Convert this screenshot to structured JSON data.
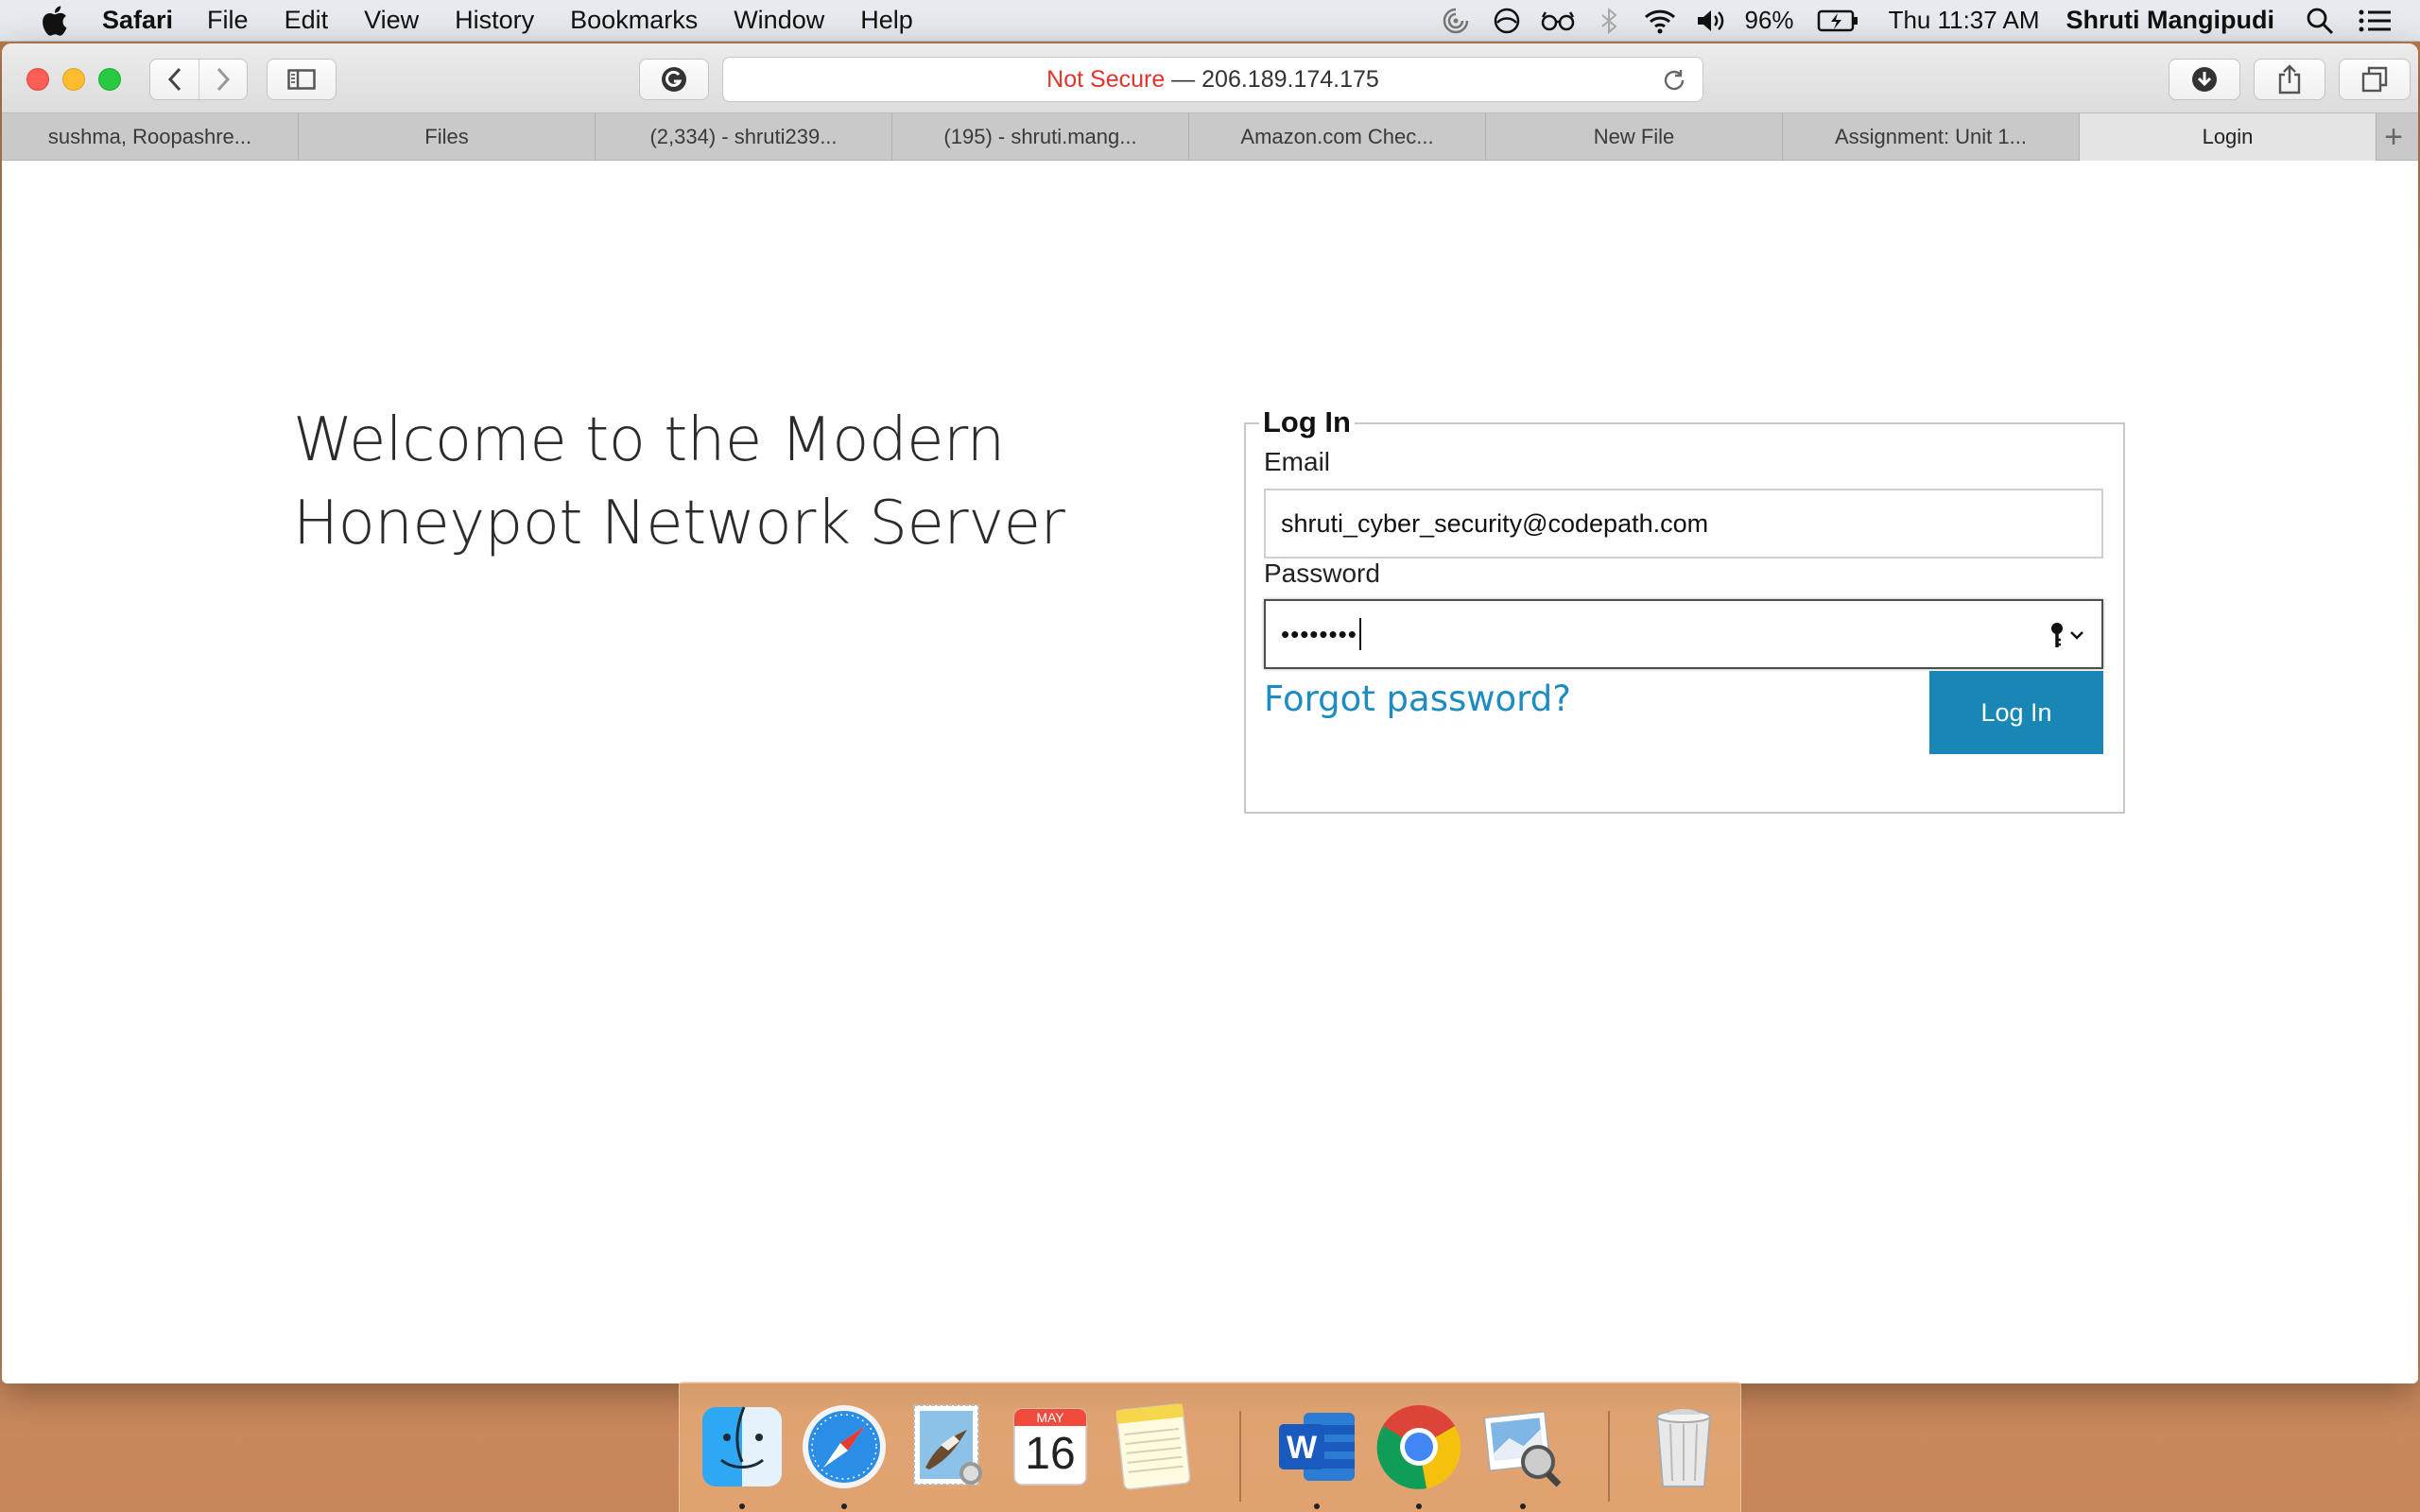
{
  "menubar": {
    "app_name": "Safari",
    "items": [
      "File",
      "Edit",
      "View",
      "History",
      "Bookmarks",
      "Window",
      "Help"
    ],
    "battery": "96%",
    "clock": "Thu 11:37 AM",
    "user": "Shruti Mangipudi"
  },
  "toolbar": {
    "url_prefix": "Not Secure",
    "url_separator": " — ",
    "url_host": "206.189.174.175"
  },
  "tabs": [
    {
      "label": "sushma, Roopashre..."
    },
    {
      "label": "Files"
    },
    {
      "label": "(2,334) - shruti239..."
    },
    {
      "label": "(195) - shruti.mang..."
    },
    {
      "label": "Amazon.com Chec..."
    },
    {
      "label": "New File"
    },
    {
      "label": "Assignment: Unit 1..."
    },
    {
      "label": "Login"
    }
  ],
  "new_tab_label": "+",
  "page": {
    "welcome_line1": "Welcome to the Modern",
    "welcome_line2": "Honeypot Network Server",
    "login": {
      "legend": "Log In",
      "email_label": "Email",
      "email_value": "shruti_cyber_security@codepath.com",
      "password_label": "Password",
      "password_mask": "••••••••",
      "forgot_link": "Forgot password?",
      "submit_label": "Log In"
    }
  },
  "dock": {
    "calendar_month": "MAY",
    "calendar_day": "16",
    "word_letter": "W"
  },
  "colors": {
    "not_secure": "#e2342a",
    "link": "#1d8cc2",
    "button": "#1987b6"
  }
}
